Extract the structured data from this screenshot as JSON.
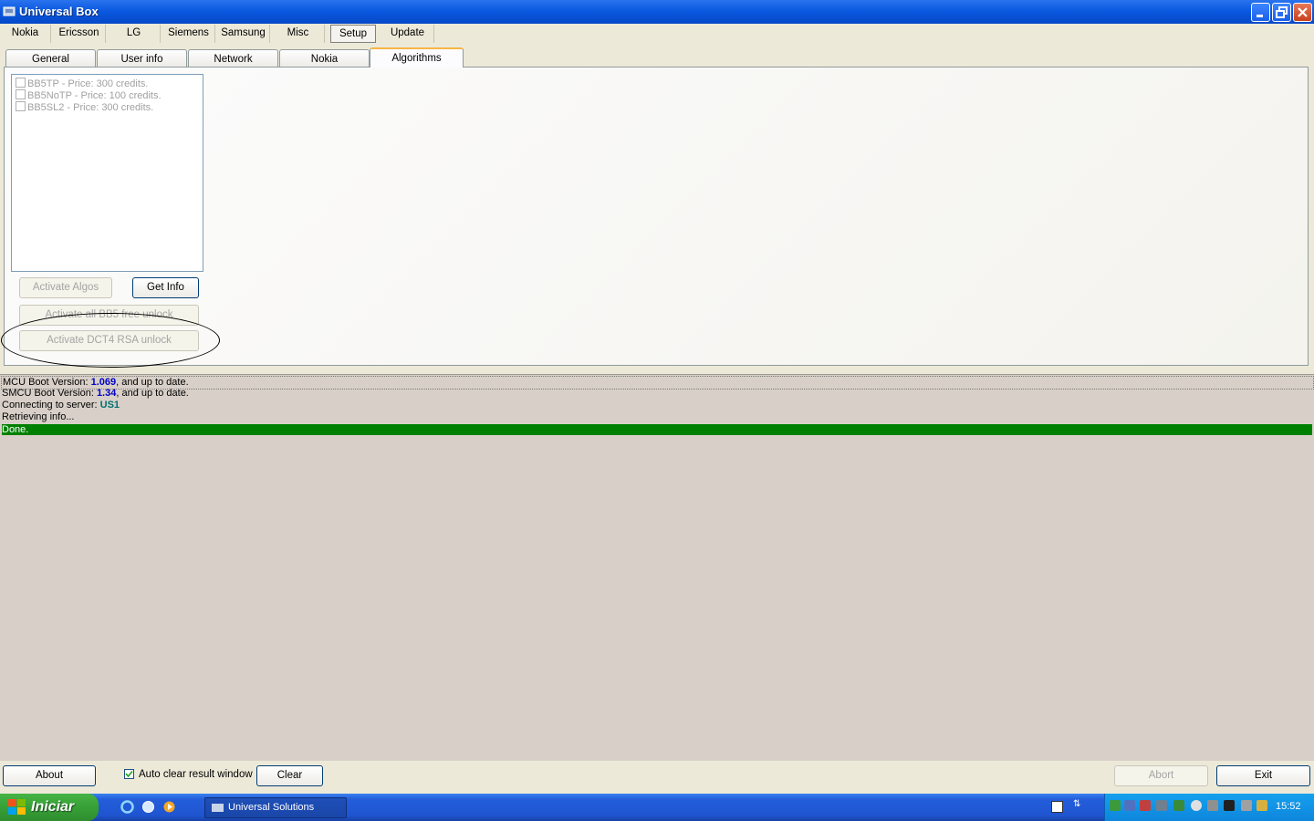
{
  "window": {
    "title": "Universal Box"
  },
  "top_tabs": [
    "Nokia",
    "Ericsson",
    "LG",
    "Siemens",
    "Samsung",
    "Misc",
    "Setup",
    "Update"
  ],
  "top_tabs_selected": "Setup",
  "setup_tabs": [
    "General",
    "User info",
    "Network",
    "Nokia",
    "Algorithms"
  ],
  "setup_tabs_selected": "Algorithms",
  "algorithms": [
    {
      "label": "BB5TP - Price: 300 credits.",
      "checked": false
    },
    {
      "label": "BB5NoTP - Price: 100 credits.",
      "checked": false
    },
    {
      "label": "BB5SL2 - Price: 300 credits.",
      "checked": false
    }
  ],
  "buttons": {
    "activate_algos": "Activate Algos",
    "get_info": "Get Info",
    "activate_bb5": "Activate all BB5 free unlock",
    "activate_dct4": "Activate DCT4 RSA unlock"
  },
  "log": {
    "line1_prefix": "MCU Boot Version: ",
    "line1_value": "1.069",
    "line1_suffix": ", and up to date.",
    "line2_prefix": "SMCU Boot Version: ",
    "line2_value": "1.34",
    "line2_suffix": ", and up to date.",
    "line3_prefix": "Connecting to server: ",
    "line3_value": "US1",
    "line4": "Retrieving info...",
    "line5": "Done."
  },
  "bottom": {
    "about": "About",
    "auto_clear": "Auto clear result window",
    "auto_clear_checked": true,
    "clear": "Clear",
    "abort": "Abort",
    "exit": "Exit"
  },
  "taskbar": {
    "start": "Iniciar",
    "task": "Universal Solutions",
    "clock": "15:52"
  }
}
